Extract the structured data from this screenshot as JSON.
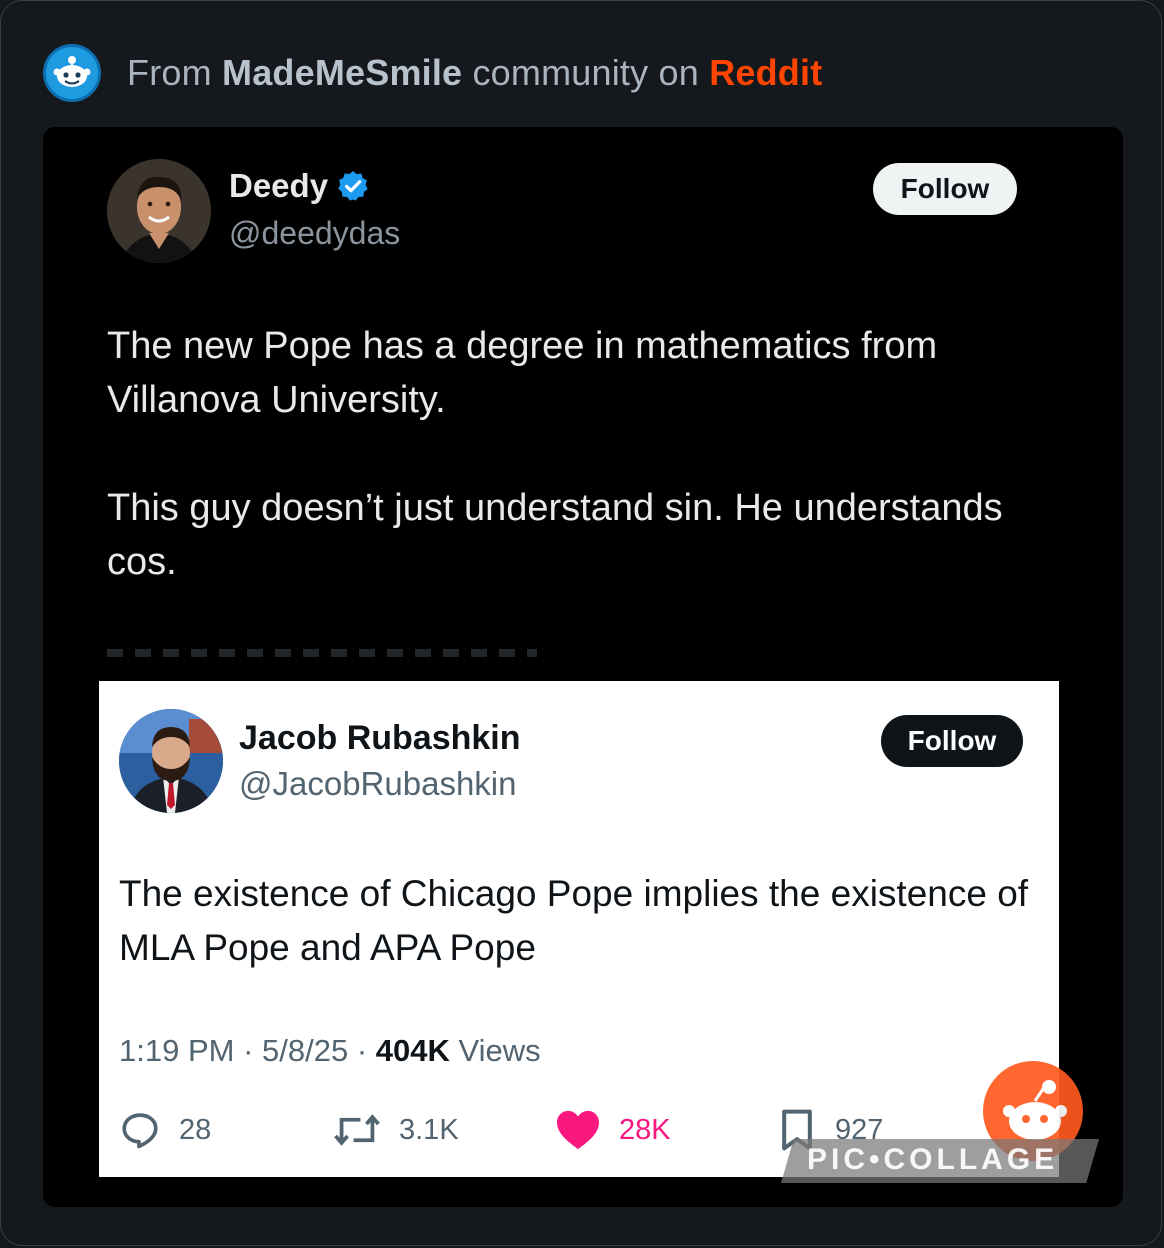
{
  "header": {
    "prefix": "From",
    "community": "MadeMeSmile",
    "middle": "community on",
    "platform": "Reddit",
    "icon": "reddit-snoo-icon",
    "brand_color": "#ff4500"
  },
  "tweet1": {
    "name": "Deedy",
    "handle": "@deedydas",
    "verified": true,
    "follow_label": "Follow",
    "paragraph1": "The new Pope has a degree in mathematics from Villanova University.",
    "paragraph2": "This guy doesn’t just understand sin. He understands cos."
  },
  "tweet2": {
    "name": "Jacob Rubashkin",
    "handle": "@JacobRubashkin",
    "follow_label": "Follow",
    "text": "The existence of Chicago Pope implies the existence of MLA Pope and APA Pope",
    "time": "1:19 PM",
    "date": "5/8/25",
    "views_count": "404K",
    "views_label": "Views",
    "actions": {
      "replies": "28",
      "retweets": "3.1K",
      "likes": "28K",
      "bookmarks": "927"
    },
    "like_color": "#f91880"
  },
  "watermark": {
    "text": "PIC•COLLAGE"
  }
}
